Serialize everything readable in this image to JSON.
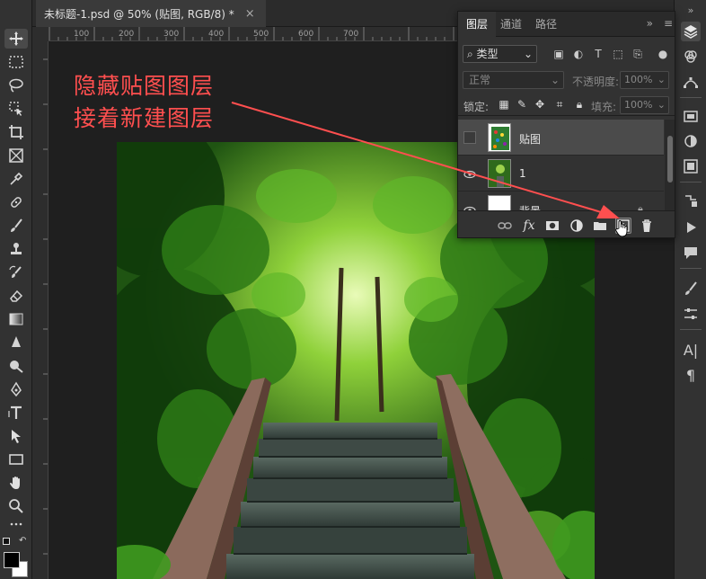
{
  "document_tab": {
    "title": "未标题-1.psd @ 50% (贴图, RGB/8) *",
    "close": "×"
  },
  "rulers": {
    "top_ticks": [
      "100",
      "200",
      "300",
      "400",
      "500",
      "600",
      "700"
    ]
  },
  "annotation": {
    "line1": "隐藏贴图图层",
    "line2": "接着新建图层",
    "color": "#ff4f4f"
  },
  "layers_panel": {
    "tabs": [
      "图层",
      "通道",
      "路径"
    ],
    "more": "»",
    "menu": "≡",
    "filter": {
      "label": "类型",
      "icon": "search-icon"
    },
    "blend_mode": "正常",
    "opacity_label": "不透明度:",
    "opacity_value": "100%",
    "lock_label": "锁定:",
    "fill_label": "填充:",
    "fill_value": "100%",
    "layers": [
      {
        "name": "贴图",
        "visible": false,
        "selected": true
      },
      {
        "name": "1",
        "visible": true,
        "selected": false
      },
      {
        "name": "背景",
        "visible": true,
        "selected": false
      }
    ],
    "bottom_icons": [
      "link-icon",
      "fx-icon",
      "mask-icon",
      "adjustment-icon",
      "group-icon",
      "new-layer-icon",
      "trash-icon"
    ]
  },
  "colors": {
    "accent_annotation": "#ff4f4f",
    "panel_bg": "#323232",
    "selected_layer": "#4b4b4b"
  }
}
